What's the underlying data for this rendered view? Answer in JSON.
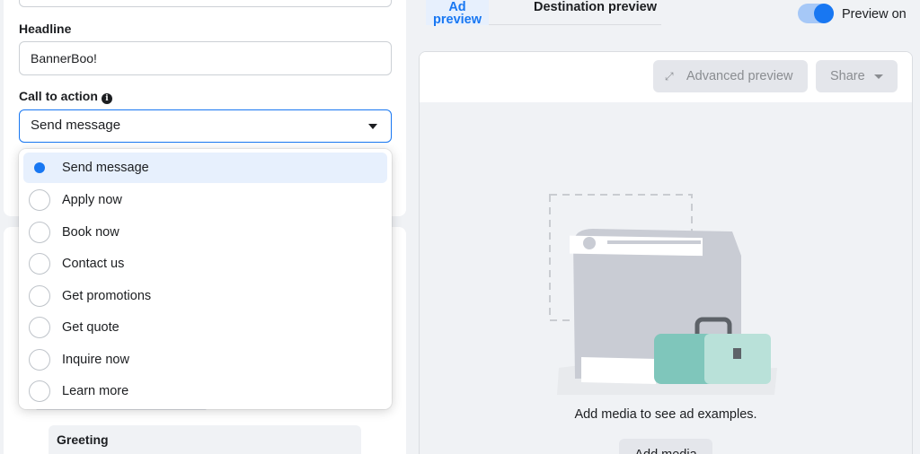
{
  "left": {
    "headline_label": "Headline",
    "headline_value": "BannerBoo!",
    "cta_label": "Call to action",
    "cta_selected": "Send message",
    "cta_options": [
      "Send message",
      "Apply now",
      "Book now",
      "Contact us",
      "Get promotions",
      "Get quote",
      "Inquire now",
      "Learn more"
    ],
    "greeting_title": "Greeting"
  },
  "right": {
    "tabs": [
      "Ad preview",
      "Destination preview"
    ],
    "preview_toggle_label": "Preview on",
    "preview_toggle_on": true,
    "advanced_preview_label": "Advanced preview",
    "share_label": "Share",
    "empty_text": "Add media to see ad examples.",
    "add_media_label": "Add media"
  },
  "colors": {
    "accent": "#1877f2",
    "selected_bg": "#e7f0fd",
    "teal": "#7fc6bb",
    "teal_light": "#b9e1d9"
  }
}
